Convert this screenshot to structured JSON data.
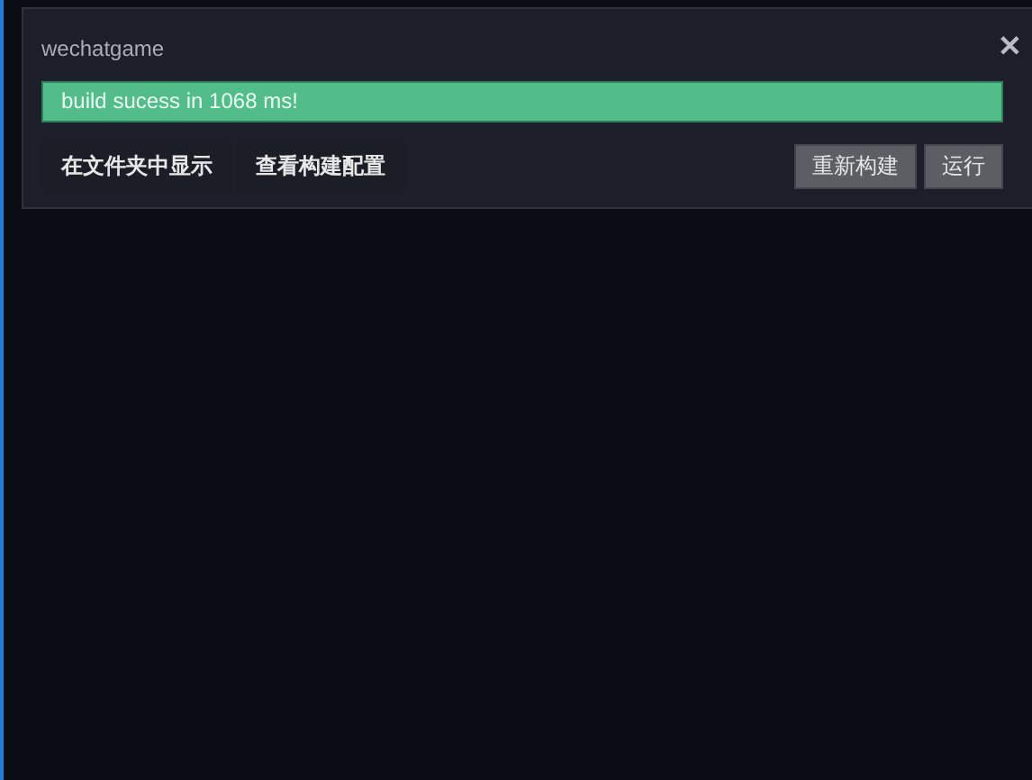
{
  "dialog": {
    "title": "wechatgame",
    "close": "✕"
  },
  "progress": {
    "text": "build sucess in 1068 ms!",
    "level": 1
  },
  "links": [
    "在文件夹中显示",
    "查看构建配置"
  ],
  "buttons": [
    "重新构建",
    "运行"
  ]
}
